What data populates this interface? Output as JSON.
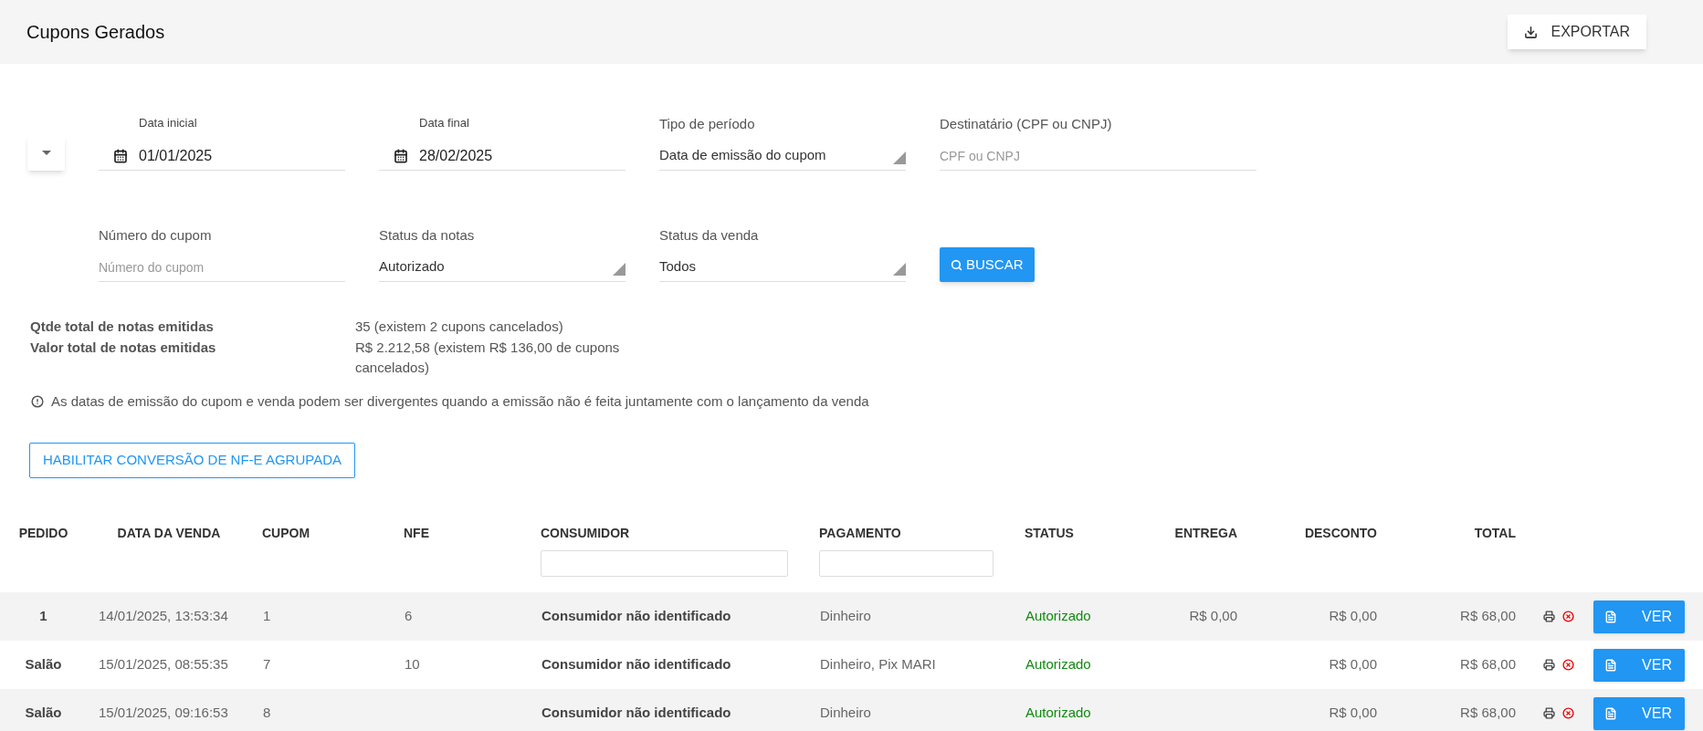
{
  "header": {
    "title": "Cupons Gerados",
    "export_label": "EXPORTAR"
  },
  "filters": {
    "rows": [
      [
        {
          "kind": "date",
          "label": "Data inicial",
          "value": "01/01/2025"
        },
        {
          "kind": "date",
          "label": "Data final",
          "value": "28/02/2025"
        },
        {
          "kind": "select",
          "label": "Tipo de período",
          "value": "Data de emissão do cupom"
        },
        {
          "kind": "text",
          "label": "Destinatário (CPF ou CNPJ)",
          "placeholder": "CPF ou CNPJ"
        }
      ],
      [
        {
          "kind": "text",
          "label": "Número do cupom",
          "placeholder": "Número do cupom"
        },
        {
          "kind": "select",
          "label": "Status da notas",
          "value": "Autorizado"
        },
        {
          "kind": "select",
          "label": "Status da venda",
          "value": "Todos"
        },
        {
          "kind": "button",
          "label": "BUSCAR"
        }
      ]
    ]
  },
  "summary": [
    {
      "label": "Qtde total de notas emitidas",
      "value": "35 (existem 2 cupons cancelados)"
    },
    {
      "label": "Valor total de notas emitidas",
      "value": "R$ 2.212,58 (existem R$ 136,00 de cupons cancelados)"
    }
  ],
  "notice": "As datas de emissão do cupom e venda podem ser divergentes quando a emissão não é feita juntamente com o lançamento da venda",
  "group_button": "HABILITAR CONVERSÃO DE NF-E AGRUPADA",
  "table": {
    "columns": [
      {
        "label": "PEDIDO",
        "kind": "plain"
      },
      {
        "label": "DATA DA VENDA",
        "kind": "plain"
      },
      {
        "label": "CUPOM",
        "kind": "plain"
      },
      {
        "label": "NFE",
        "kind": "plain"
      },
      {
        "label": "CONSUMIDOR",
        "kind": "filter"
      },
      {
        "label": "PAGAMENTO",
        "kind": "filter"
      },
      {
        "label": "STATUS",
        "kind": "plain"
      },
      {
        "label": "ENTREGA",
        "kind": "plain"
      },
      {
        "label": "DESCONTO",
        "kind": "plain"
      },
      {
        "label": "TOTAL",
        "kind": "plain"
      }
    ],
    "rows": [
      {
        "cells": [
          "1",
          "14/01/2025, 13:53:34",
          "1",
          "6",
          "Consumidor não identificado",
          "Dinheiro",
          "Autorizado",
          "R$ 0,00",
          "R$ 0,00",
          "R$ 68,00"
        ],
        "action": "VER"
      },
      {
        "cells": [
          "Salão",
          "15/01/2025, 08:55:35",
          "7",
          "10",
          "Consumidor não identificado",
          "Dinheiro, Pix MARI",
          "Autorizado",
          "",
          "R$ 0,00",
          "R$ 68,00"
        ],
        "action": "VER"
      },
      {
        "cells": [
          "Salão",
          "15/01/2025, 09:16:53",
          "8",
          "",
          "Consumidor não identificado",
          "Dinheiro",
          "Autorizado",
          "",
          "R$ 0,00",
          "R$ 68,00"
        ],
        "action": "VER"
      }
    ]
  }
}
